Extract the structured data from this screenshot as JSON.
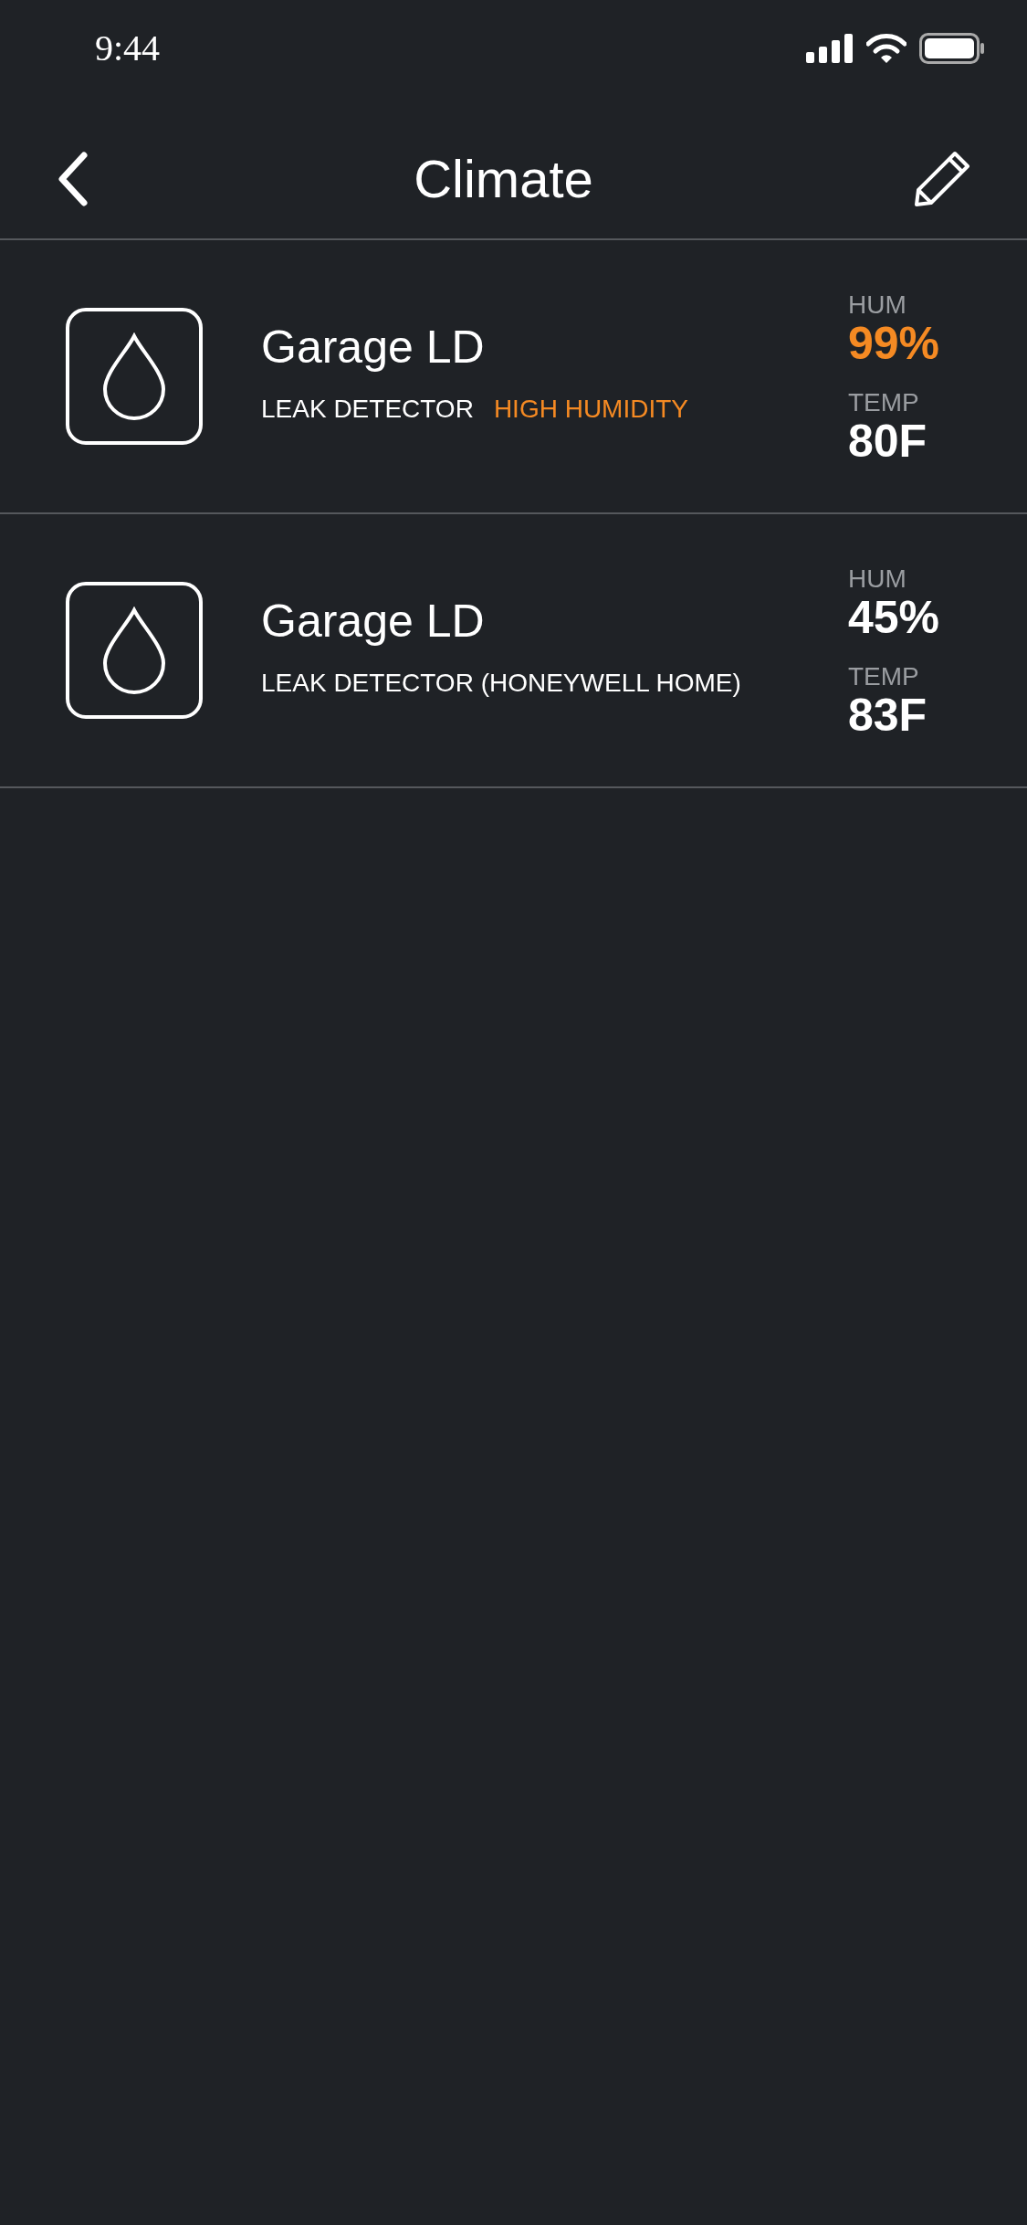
{
  "status_bar": {
    "time": "9:44"
  },
  "header": {
    "title": "Climate"
  },
  "devices": [
    {
      "name": "Garage LD",
      "type": "LEAK DETECTOR",
      "alert": "HIGH HUMIDITY",
      "hum_label": "HUM",
      "hum": "99%",
      "hum_alert": true,
      "temp_label": "TEMP",
      "temp": "80F"
    },
    {
      "name": "Garage LD",
      "type": "LEAK DETECTOR (HONEYWELL HOME)",
      "hum_label": "HUM",
      "hum": "45%",
      "hum_alert": false,
      "temp_label": "TEMP",
      "temp": "83F"
    }
  ]
}
